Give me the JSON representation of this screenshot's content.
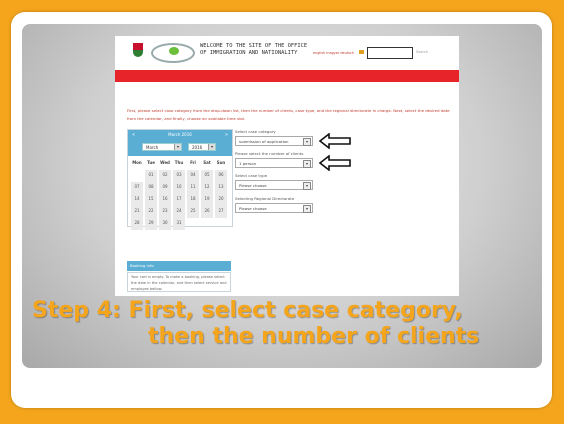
{
  "header": {
    "title_line1": "WELCOME TO THE SITE OF THE OFFICE",
    "title_line2": "OF IMMIGRATION AND NATIONALITY",
    "lang_links": "english magyar deutsch",
    "search_label": "Search"
  },
  "instructions": "First, please select case category from the drop-down list, then the number of clients, case type, and the regional directorate in charge. Next, select the desired date from the calendar, and finally, choose an available time slot.",
  "calendar": {
    "title": "March 2016",
    "prev": "«",
    "next": "»",
    "month": "March",
    "year": "2016",
    "weekdays": [
      "Mon",
      "Tue",
      "Wed",
      "Thu",
      "Fri",
      "Sat",
      "Sun"
    ],
    "weeks": [
      [
        "",
        "01",
        "02",
        "03",
        "04",
        "05",
        "06"
      ],
      [
        "07",
        "08",
        "09",
        "10",
        "11",
        "12",
        "13"
      ],
      [
        "14",
        "15",
        "16",
        "17",
        "18",
        "19",
        "20"
      ],
      [
        "21",
        "22",
        "23",
        "24",
        "25",
        "26",
        "27"
      ],
      [
        "28",
        "29",
        "30",
        "31",
        "",
        "",
        ""
      ]
    ]
  },
  "booking": {
    "title": "Booking info",
    "text": "Your cart is empty. To make a booking, please select the date in the calendar, and then select service and employee bellow."
  },
  "form": {
    "case_category_label": "Select case category",
    "case_category_value": "submission of application",
    "clients_label": "Please select the number of clients",
    "clients_value": "1 person",
    "case_type_label": "Select case type",
    "case_type_value": "Please choose",
    "directorate_label": "Selecting Regional Directorate",
    "directorate_value": "Please choose"
  },
  "caption": {
    "line1": "Step 4: First, select case category,",
    "line2": "then the number of clients"
  },
  "colors": {
    "accent": "#f4a51c",
    "red_bar": "#e8242b",
    "calendar_blue": "#5aaed4"
  }
}
